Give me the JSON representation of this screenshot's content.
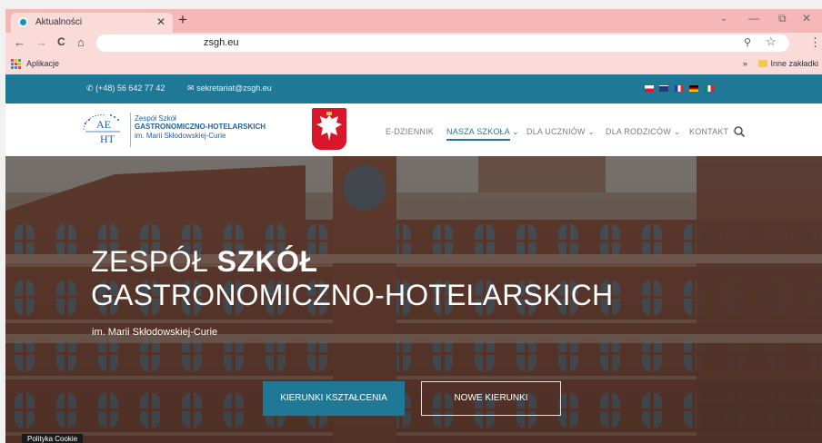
{
  "browser": {
    "tab_title": "Aktualności",
    "tab_close": "✕",
    "new_tab": "+",
    "url": "zsgh.eu",
    "minimize": "—",
    "maximize": "⧉",
    "close": "✕",
    "back": "←",
    "forward": "→",
    "reload": "C",
    "home": "⌂",
    "zoom_icon": "⚲",
    "star_icon": "☆",
    "menu_icon": "⋮",
    "bookmarks_label": "Aplikacje",
    "bookmarks_more": "»",
    "other_bookmarks": "Inne zakładki"
  },
  "site": {
    "phone": "(+48) 56 642 77 42",
    "email": "sekretariat@zsgh.eu",
    "logo": {
      "mark_top": "AE",
      "mark_bottom": "HT",
      "line1": "Zespół Szkół",
      "line2": "GASTRONOMICZNO-HOTELARSKICH",
      "line3": "im. Marii Skłodowskiej-Curie"
    },
    "nav": [
      {
        "label": "E-DZIENNIK"
      },
      {
        "label": "NASZA SZKOŁA ⌄"
      },
      {
        "label": "DLA UCZNIÓW ⌄"
      },
      {
        "label": "DLA RODZICÓW ⌄"
      },
      {
        "label": "KONTAKT"
      }
    ],
    "hero": {
      "title_regular": "ZESPÓŁ ",
      "title_bold": "SZKÓŁ",
      "title_line2": "GASTRONOMICZNO-HOTELARSKICH",
      "subtitle": "im. Marii Skłodowskiej-Curie",
      "button_primary": "KIERUNKI KSZTAŁCENIA",
      "button_secondary": "NOWE KIERUNKI"
    },
    "cookie": "Polityka Cookie"
  },
  "colors": {
    "accent": "#1f7895",
    "chrome": "#f6b7b7"
  }
}
